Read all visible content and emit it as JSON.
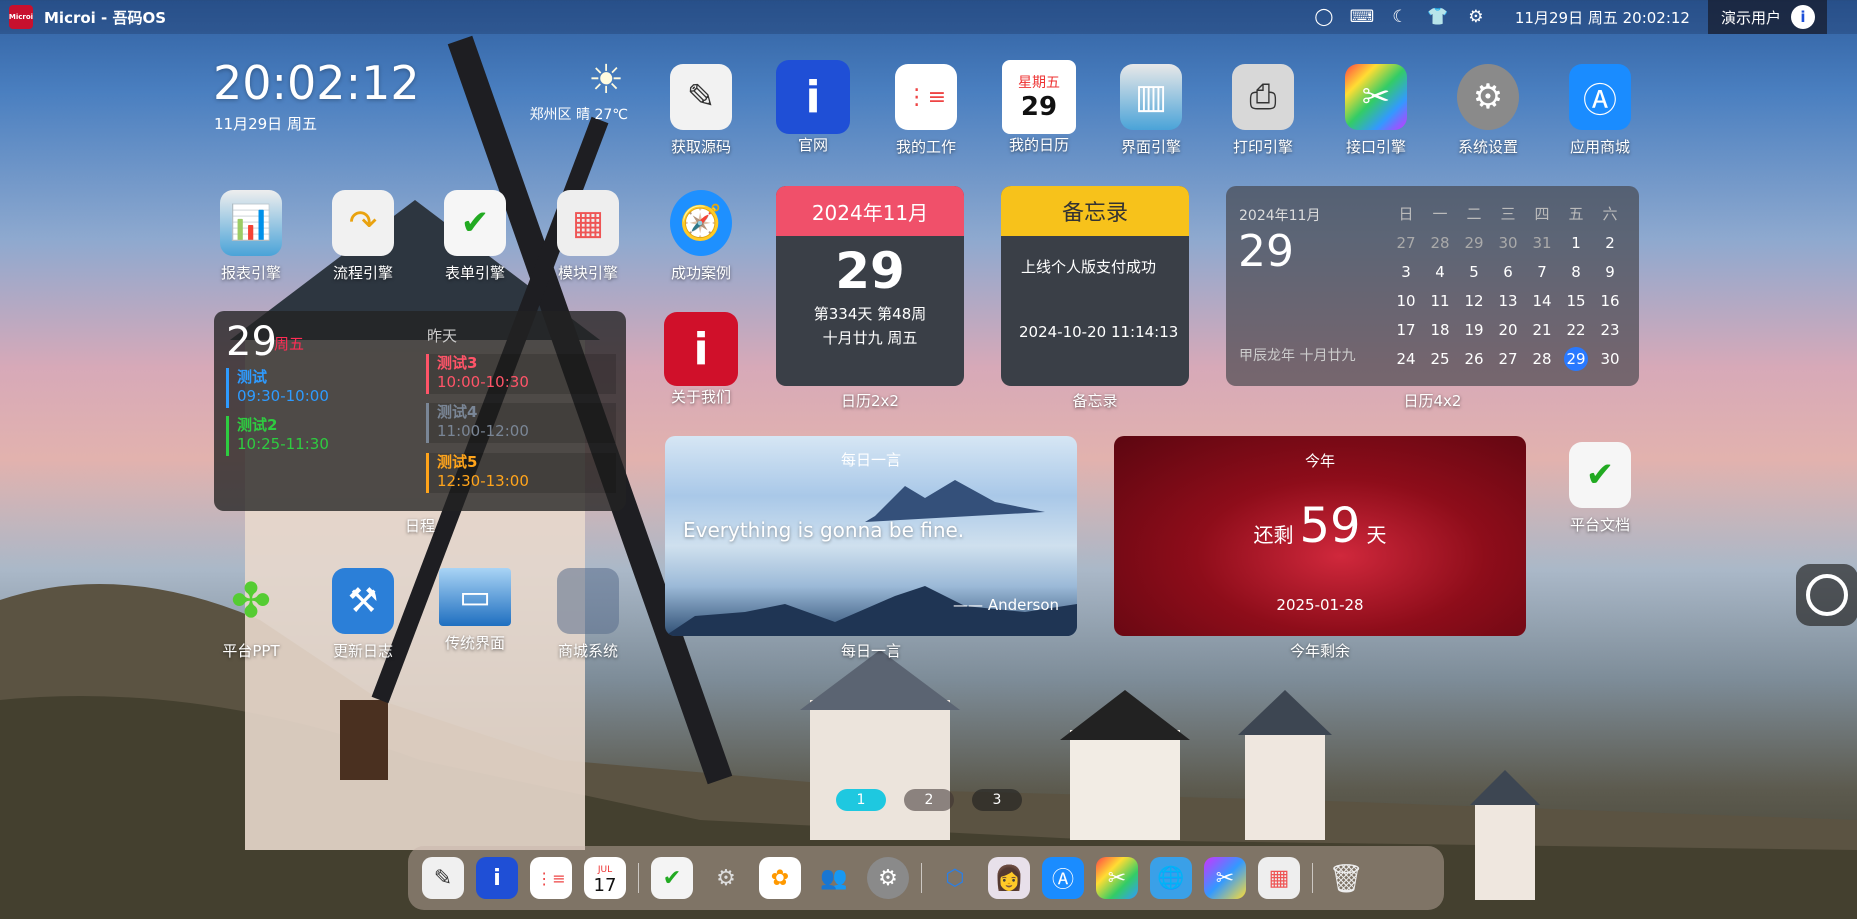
{
  "topbar": {
    "logo_text": "Microi",
    "title": "Microi - 吾码OS",
    "datetime": "11月29日 周五 20:02:12",
    "user": "演示用户",
    "avatar_letter": "i",
    "tray_icons": [
      "chat-icon",
      "keyboard-icon",
      "moon-icon",
      "tshirt-icon",
      "gear-icon"
    ]
  },
  "clock": {
    "time": "20:02:12",
    "date": "11月29日 周五"
  },
  "weather": {
    "text": "郑州区 晴 27℃",
    "icon": "sun-icon"
  },
  "icons": {
    "source": "获取源码",
    "site": "官网",
    "work": "我的工作",
    "mycal": "我的日历",
    "ui": "界面引擎",
    "print": "打印引擎",
    "api": "接口引擎",
    "settings": "系统设置",
    "store": "应用商城",
    "report": "报表引擎",
    "flow": "流程引擎",
    "form": "表单引擎",
    "module": "模块引擎",
    "cases": "成功案例",
    "about": "关于我们",
    "doc": "平台文档",
    "ppt": "平台PPT",
    "log": "更新日志",
    "legacy": "传统界面",
    "mall": "商城系统",
    "mycal_weekday": "星期五",
    "mycal_day": "29"
  },
  "schedule": {
    "label": "日程",
    "day": "29",
    "weekday": "周五",
    "yesterday": "昨天",
    "events": [
      {
        "title": "测试",
        "time": "09:30-10:00",
        "color": "#2e9bff"
      },
      {
        "title": "测试2",
        "time": "10:25-11:30",
        "color": "#2ecc40"
      },
      {
        "title": "测试3",
        "time": "10:00-10:30",
        "color": "#ff5468"
      },
      {
        "title": "测试4",
        "time": "11:00-12:00",
        "color": "#7a8696"
      },
      {
        "title": "测试5",
        "time": "12:30-13:00",
        "color": "#ffa41b"
      }
    ]
  },
  "cal2x2": {
    "label": "日历2x2",
    "header": "2024年11月",
    "day": "29",
    "line1": "第334天 第48周",
    "line2": "十月廿九 周五"
  },
  "memo": {
    "label": "备忘录",
    "header": "备忘录",
    "text": "上线个人版支付成功",
    "time": "2024-10-20 11:14:13"
  },
  "cal4x2": {
    "label": "日历4x2",
    "ym": "2024年11月",
    "day": "29",
    "lunar": "甲辰龙年 十月廿九",
    "weekdays": [
      "日",
      "一",
      "二",
      "三",
      "四",
      "五",
      "六"
    ],
    "days": [
      "27",
      "28",
      "29",
      "30",
      "31",
      "1",
      "2",
      "3",
      "4",
      "5",
      "6",
      "7",
      "8",
      "9",
      "10",
      "11",
      "12",
      "13",
      "14",
      "15",
      "16",
      "17",
      "18",
      "19",
      "20",
      "21",
      "22",
      "23",
      "24",
      "25",
      "26",
      "27",
      "28",
      "29",
      "30"
    ]
  },
  "quote": {
    "label": "每日一言",
    "title": "每日一言",
    "text": "Everything is gonna be fine.",
    "author": "—— Anderson"
  },
  "year": {
    "label": "今年剩余",
    "title": "今年",
    "prefix": "还剩",
    "days": "59",
    "suffix": "天",
    "date": "2025-01-28"
  },
  "pages": [
    "1",
    "2",
    "3"
  ],
  "dock": {
    "items": [
      "pen-app-icon",
      "microi-icon",
      "reminders-icon",
      "calendar-icon",
      "form-doc-icon",
      "gear-app-icon",
      "photos-icon",
      "users-icon",
      "system-settings-icon",
      "box-icon",
      "avatar-girl-icon",
      "app-store-icon",
      "api-tools-icon",
      "globe-icon",
      "color-tools-icon",
      "module-grid-icon",
      "trash-icon"
    ],
    "cal_month": "JUL",
    "cal_day": "17"
  }
}
